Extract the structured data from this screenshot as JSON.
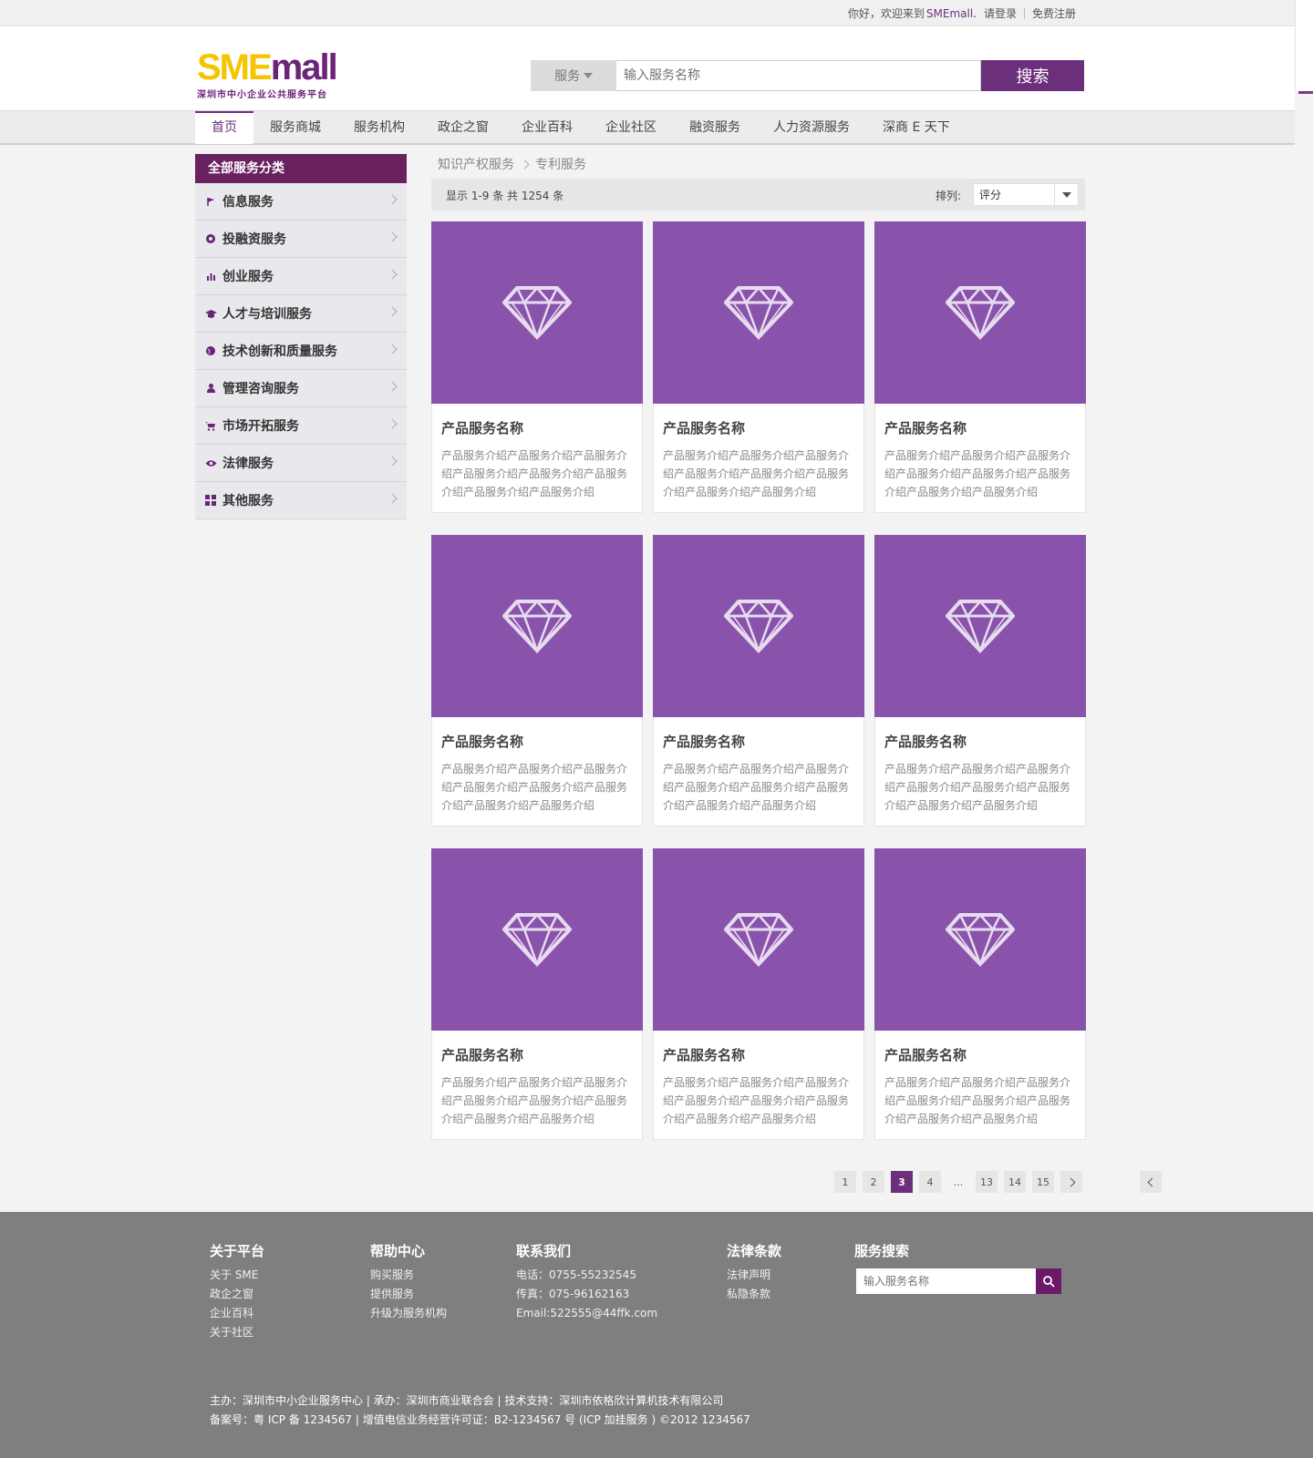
{
  "topbar": {
    "greeting": "你好，欢迎来到",
    "brand": "SMEmall.",
    "login": "请登录",
    "register": "免费注册"
  },
  "logo": {
    "main_a": "SME",
    "main_b": "mall",
    "subtitle": "深圳市中小企业公共服务平台"
  },
  "search": {
    "category": "服务",
    "placeholder": "输入服务名称",
    "button": "搜索"
  },
  "nav": [
    "首页",
    "服务商城",
    "服务机构",
    "政企之窗",
    "企业百科",
    "企业社区",
    "融资服务",
    "人力资源服务",
    "深商 E 天下"
  ],
  "sidebar": {
    "title": "全部服务分类",
    "items": [
      {
        "label": "信息服务",
        "icon": "flag-icon"
      },
      {
        "label": "投融资服务",
        "icon": "gear-icon"
      },
      {
        "label": "创业服务",
        "icon": "bar-chart-icon"
      },
      {
        "label": "人才与培训服务",
        "icon": "graduation-cap-icon"
      },
      {
        "label": "技术创新和质量服务",
        "icon": "globe-icon"
      },
      {
        "label": "管理咨询服务",
        "icon": "user-icon"
      },
      {
        "label": "市场开拓服务",
        "icon": "cart-icon"
      },
      {
        "label": "法律服务",
        "icon": "eye-icon"
      },
      {
        "label": "其他服务",
        "icon": "grid-icon"
      }
    ]
  },
  "breadcrumb": [
    "知识产权服务",
    "专利服务"
  ],
  "toolbar": {
    "count": "显示 1-9 条 共 1254 条",
    "sort_label": "排列:",
    "sort_value": "评分"
  },
  "products": [
    {
      "title": "产品服务名称",
      "desc": "产品服务介绍产品服务介绍产品服务介绍产品服务介绍产品服务介绍产品服务介绍产品服务介绍产品服务介绍"
    },
    {
      "title": "产品服务名称",
      "desc": "产品服务介绍产品服务介绍产品服务介绍产品服务介绍产品服务介绍产品服务介绍产品服务介绍产品服务介绍"
    },
    {
      "title": "产品服务名称",
      "desc": "产品服务介绍产品服务介绍产品服务介绍产品服务介绍产品服务介绍产品服务介绍产品服务介绍产品服务介绍"
    },
    {
      "title": "产品服务名称",
      "desc": "产品服务介绍产品服务介绍产品服务介绍产品服务介绍产品服务介绍产品服务介绍产品服务介绍产品服务介绍"
    },
    {
      "title": "产品服务名称",
      "desc": "产品服务介绍产品服务介绍产品服务介绍产品服务介绍产品服务介绍产品服务介绍产品服务介绍产品服务介绍"
    },
    {
      "title": "产品服务名称",
      "desc": "产品服务介绍产品服务介绍产品服务介绍产品服务介绍产品服务介绍产品服务介绍产品服务介绍产品服务介绍"
    },
    {
      "title": "产品服务名称",
      "desc": "产品服务介绍产品服务介绍产品服务介绍产品服务介绍产品服务介绍产品服务介绍产品服务介绍产品服务介绍"
    },
    {
      "title": "产品服务名称",
      "desc": "产品服务介绍产品服务介绍产品服务介绍产品服务介绍产品服务介绍产品服务介绍产品服务介绍产品服务介绍"
    },
    {
      "title": "产品服务名称",
      "desc": "产品服务介绍产品服务介绍产品服务介绍产品服务介绍产品服务介绍产品服务介绍产品服务介绍产品服务介绍"
    }
  ],
  "pagination": {
    "pages": [
      "1",
      "2",
      "3",
      "4",
      "...",
      "13",
      "14",
      "15"
    ],
    "current": "3"
  },
  "footer": {
    "about": {
      "title": "关于平台",
      "links": [
        "关于 SME",
        "政企之窗",
        "企业百科",
        "关于社区"
      ]
    },
    "help": {
      "title": "帮助中心",
      "links": [
        "购买服务",
        "提供服务",
        "升级为服务机构"
      ]
    },
    "contact": {
      "title": "联系我们",
      "links": [
        "电话：0755-55232545",
        "传真：075-96162163",
        "Email:522555@44ffk.com"
      ]
    },
    "legal": {
      "title": "法律条款",
      "links": [
        "法律声明",
        "私隐条款"
      ]
    },
    "search": {
      "title": "服务搜索",
      "placeholder": "输入服务名称"
    },
    "line1": "主办：深圳市中小企业服务中心 | 承办：深圳市商业联合会 | 技术支持：深圳市依格欣计算机技术有限公司",
    "line2": "备案号：粤 ICP 备 1234567 | 增值电信业务经营许可证：B2-1234567 号 (ICP 加挂服务 )  ©2012 1234567"
  },
  "colors": {
    "brand_purple": "#6c2f7c",
    "card_purple": "#8a53ab",
    "logo_yellow": "#f6c400",
    "footer_gray": "#7f7f7f"
  }
}
